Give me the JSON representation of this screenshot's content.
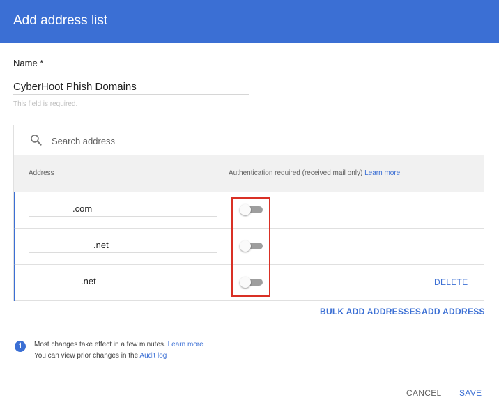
{
  "dialog": {
    "title": "Add address list"
  },
  "name_field": {
    "label": "Name *",
    "value": "CyberHoot Phish Domains",
    "helper": "This field is required."
  },
  "search": {
    "placeholder": "Search address"
  },
  "table": {
    "col_address": "Address",
    "col_auth": "Authentication required (received mail only)",
    "col_auth_link": "Learn more",
    "rows": [
      {
        "address": ".com",
        "auth_required": false
      },
      {
        "address": ".net",
        "auth_required": false
      },
      {
        "address": ".net",
        "auth_required": false
      }
    ],
    "delete_label": "DELETE"
  },
  "actions": {
    "bulk_add": "BULK ADD ADDRESSES",
    "add": "ADD ADDRESS"
  },
  "info": {
    "line1": "Most changes take effect in a few minutes.",
    "line1_link": "Learn more",
    "line2": "You can view prior changes in the",
    "line2_link": "Audit log"
  },
  "footer": {
    "cancel": "CANCEL",
    "save": "SAVE"
  },
  "colors": {
    "accent": "#3b6fd4",
    "highlight": "#d93025"
  },
  "icons": {
    "search": "search-icon",
    "info": "info-icon"
  }
}
